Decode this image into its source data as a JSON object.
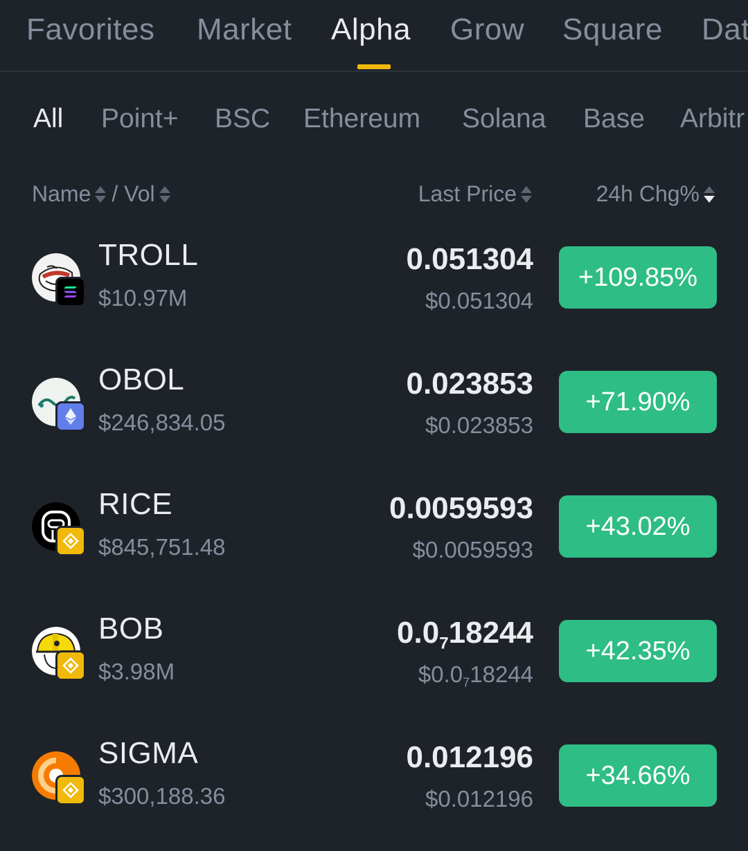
{
  "top_tabs": [
    {
      "label": "Favorites"
    },
    {
      "label": "Market"
    },
    {
      "label": "Alpha"
    },
    {
      "label": "Grow"
    },
    {
      "label": "Square"
    },
    {
      "label": "Dat"
    }
  ],
  "active_top_tab": "Alpha",
  "chains": [
    {
      "label": "All"
    },
    {
      "label": "Point+"
    },
    {
      "label": "BSC"
    },
    {
      "label": "Ethereum"
    },
    {
      "label": "Solana"
    },
    {
      "label": "Base"
    },
    {
      "label": "Arbitr"
    }
  ],
  "active_chain": "All",
  "header": {
    "name": "Name",
    "sep": "/ Vol",
    "last_price": "Last Price",
    "chg": "24h Chg%"
  },
  "colors": {
    "background": "#1e2329",
    "accent": "#f0b90b",
    "positive": "#2ebd85",
    "muted": "#848e9c"
  },
  "tokens": [
    {
      "symbol": "TROLL",
      "volume": "$10.97M",
      "price_pre": "0.051304",
      "price_sub": "",
      "price_post": "",
      "usd_pre": "$0.051304",
      "usd_sub": "",
      "usd_post": "",
      "change": "+109.85%",
      "logo_icon": "troll-face-icon",
      "chain_icon": "solana-icon"
    },
    {
      "symbol": "OBOL",
      "volume": "$246,834.05",
      "price_pre": "0.023853",
      "price_sub": "",
      "price_post": "",
      "usd_pre": "$0.023853",
      "usd_sub": "",
      "usd_post": "",
      "change": "+71.90%",
      "logo_icon": "obol-wave-icon",
      "chain_icon": "ethereum-icon"
    },
    {
      "symbol": "RICE",
      "volume": "$845,751.48",
      "price_pre": "0.0059593",
      "price_sub": "",
      "price_post": "",
      "usd_pre": "$0.0059593",
      "usd_sub": "",
      "usd_post": "",
      "change": "+43.02%",
      "logo_icon": "rice-robot-icon",
      "chain_icon": "bnb-chain-icon"
    },
    {
      "symbol": "BOB",
      "volume": "$3.98M",
      "price_pre": "0.0",
      "price_sub": "7",
      "price_post": "18244",
      "usd_pre": "$0.0",
      "usd_sub": "7",
      "usd_post": "18244",
      "change": "+42.35%",
      "logo_icon": "builder-helmet-icon",
      "chain_icon": "bnb-chain-icon"
    },
    {
      "symbol": "SIGMA",
      "volume": "$300,188.36",
      "price_pre": "0.012196",
      "price_sub": "",
      "price_post": "",
      "usd_pre": "$0.012196",
      "usd_sub": "",
      "usd_post": "",
      "change": "+34.66%",
      "logo_icon": "sigma-orange-icon",
      "chain_icon": "bnb-chain-icon"
    }
  ]
}
